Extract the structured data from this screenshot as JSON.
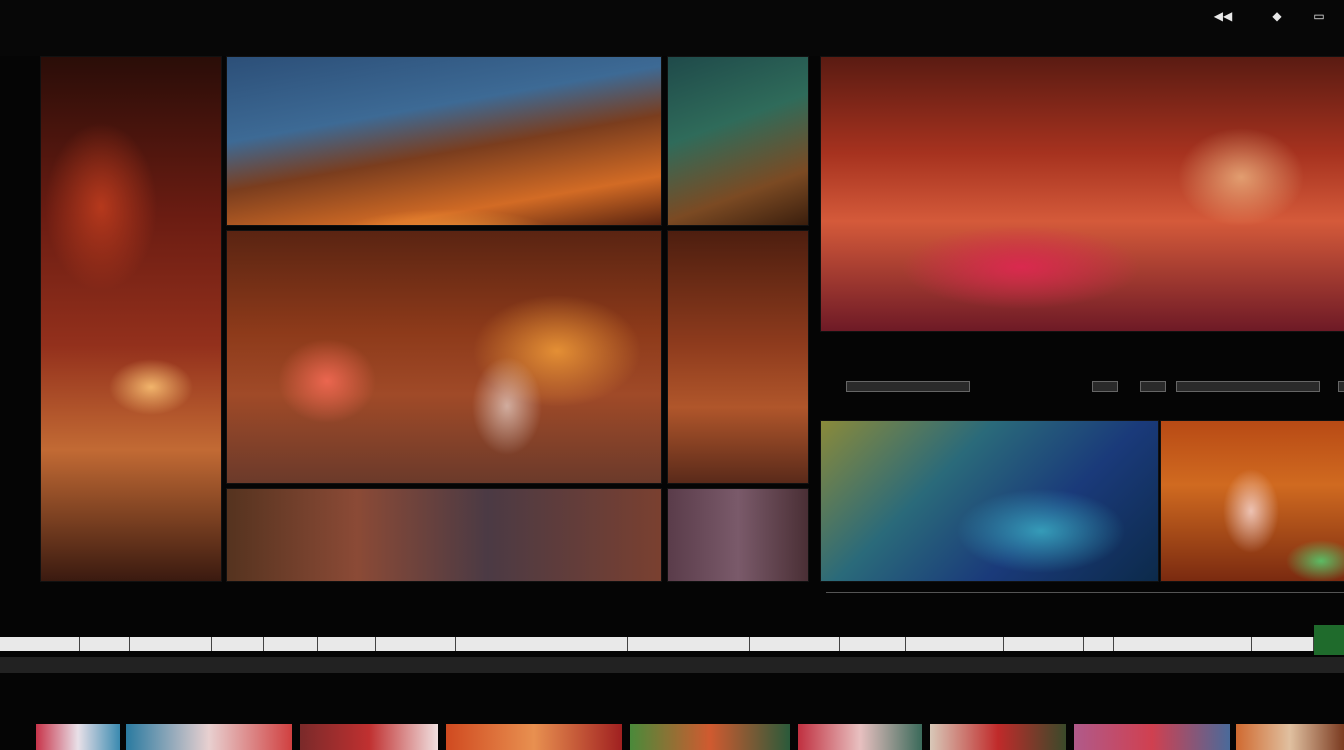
{
  "header": {
    "title": "",
    "subtitle": "",
    "window_buttons": [
      {
        "name": "back-icon",
        "glyph": "◀◀"
      },
      {
        "name": "diamond-icon",
        "glyph": "◆"
      },
      {
        "name": "window-icon",
        "glyph": "▭"
      }
    ]
  },
  "sidebar": {
    "items": [
      "",
      "",
      "",
      "",
      "",
      "",
      "",
      "",
      "",
      "",
      "",
      "",
      "",
      "",
      "",
      "",
      "",
      ""
    ]
  },
  "preview": {
    "time_left": "",
    "time_center": "",
    "time_right": ""
  },
  "properties": {
    "section_label": "",
    "section_label_2": "",
    "params_label": ""
  },
  "timeline": {
    "labels": [
      "",
      "",
      "",
      "",
      "",
      ""
    ],
    "segments": [
      "",
      "",
      "",
      "",
      "",
      "",
      "",
      "",
      "",
      "",
      "",
      "",
      "",
      "",
      "",
      ""
    ],
    "play_label": ""
  },
  "bottombar": {
    "left": "",
    "middle": "",
    "row2_left": "",
    "row2_middle": "",
    "row3_left": "",
    "row3_middle": ""
  },
  "colors": {
    "accent_title": "#ff9a3c",
    "play_button": "#1f6b2c",
    "track_bg": "#e9e9e9"
  }
}
